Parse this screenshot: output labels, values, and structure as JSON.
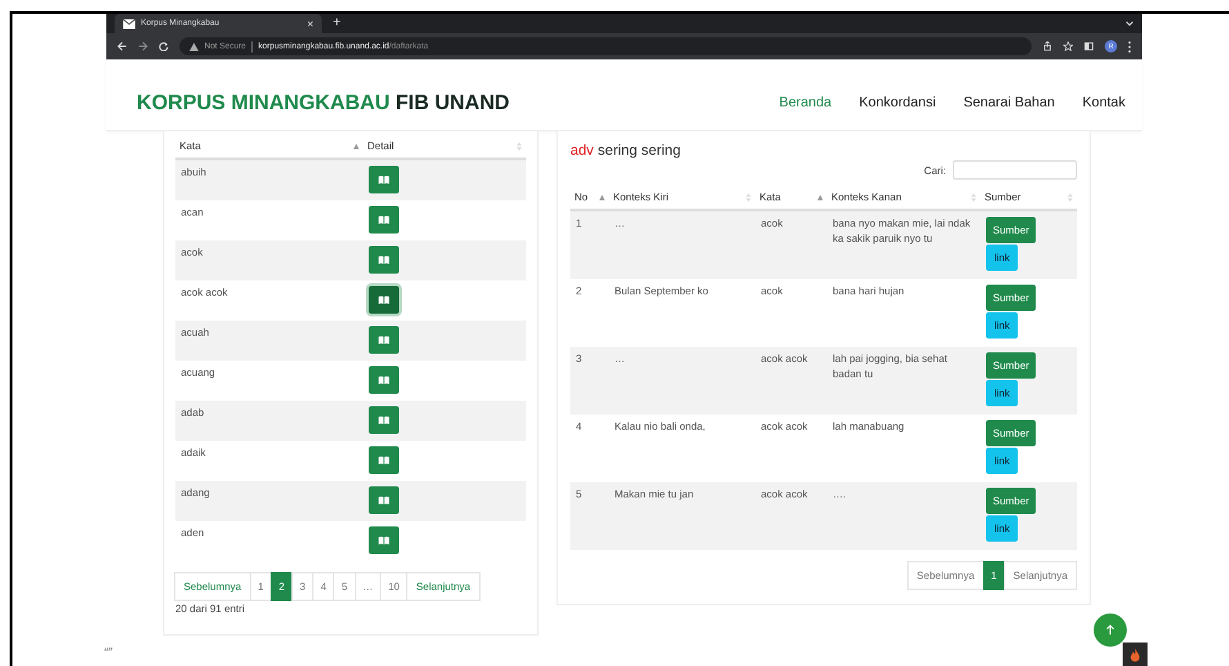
{
  "browser": {
    "tab_title": "Korpus Minangkabau",
    "tab_close": "×",
    "new_tab": "+",
    "security": "Not Secure",
    "url_host": "korpusminangkabau.fib.unand.ac.id",
    "url_path": "/daftarkata",
    "avatar": "R"
  },
  "site": {
    "brand_main": "KORPUS MINANGKABAU",
    "brand_accent": "FIB UNAND",
    "nav": [
      {
        "label": "Beranda",
        "selected": true
      },
      {
        "label": "Konkordansi",
        "selected": false
      },
      {
        "label": "Senarai Bahan",
        "selected": false
      },
      {
        "label": "Kontak",
        "selected": false
      }
    ]
  },
  "word_list": {
    "columns": [
      {
        "label": "Kata",
        "sorted": true
      },
      {
        "label": "Detail",
        "sorted": false
      }
    ],
    "rows": [
      {
        "word": "abuih",
        "focused": false
      },
      {
        "word": "acan",
        "focused": false
      },
      {
        "word": "acok",
        "focused": false
      },
      {
        "word": "acok acok",
        "focused": true
      },
      {
        "word": "acuah",
        "focused": false
      },
      {
        "word": "acuang",
        "focused": false
      },
      {
        "word": "adab",
        "focused": false
      },
      {
        "word": "adaik",
        "focused": false
      },
      {
        "word": "adang",
        "focused": false
      },
      {
        "word": "aden",
        "focused": false
      }
    ],
    "pagination": {
      "prev": "Sebelumnya",
      "next": "Selanjutnya",
      "pages": [
        {
          "label": "1",
          "selected": false
        },
        {
          "label": "2",
          "selected": true
        },
        {
          "label": "3",
          "selected": false
        },
        {
          "label": "4",
          "selected": false
        },
        {
          "label": "5",
          "selected": false
        },
        {
          "label": "…",
          "selected": false
        },
        {
          "label": "10",
          "selected": false
        }
      ]
    },
    "info": "20 dari 91 entri"
  },
  "concordance": {
    "pos": "adv",
    "title": "sering sering",
    "search_label": "Cari:",
    "columns": [
      {
        "label": "No",
        "sorted": true
      },
      {
        "label": "Konteks Kiri",
        "sorted": false
      },
      {
        "label": "Kata",
        "sorted": true
      },
      {
        "label": "Konteks Kanan",
        "sorted": false
      },
      {
        "label": "Sumber",
        "sorted": false
      }
    ],
    "rows": [
      {
        "no": "1",
        "left": "…",
        "word": "acok",
        "right": "bana nyo makan mie, lai ndak ka sakik paruik nyo tu",
        "source_button": "Sumber",
        "link_button": "link"
      },
      {
        "no": "2",
        "left": "Bulan September ko",
        "word": "acok",
        "right": "bana hari hujan",
        "source_button": "Sumber",
        "link_button": "link"
      },
      {
        "no": "3",
        "left": "…",
        "word": "acok acok",
        "right": "lah pai jogging, bia sehat badan tu",
        "source_button": "Sumber",
        "link_button": "link"
      },
      {
        "no": "4",
        "left": "Kalau nio bali onda,",
        "word": "acok acok",
        "right": "lah manabuang",
        "source_button": "Sumber",
        "link_button": "link"
      },
      {
        "no": "5",
        "left": "Makan mie tu jan",
        "word": "acok acok",
        "right": "….",
        "source_button": "Sumber",
        "link_button": "link"
      }
    ],
    "pagination": {
      "prev": "Sebelumnya",
      "next": "Selanjutnya",
      "pages": [
        {
          "label": "1",
          "selected": true
        }
      ]
    }
  },
  "footer_text": "“”"
}
